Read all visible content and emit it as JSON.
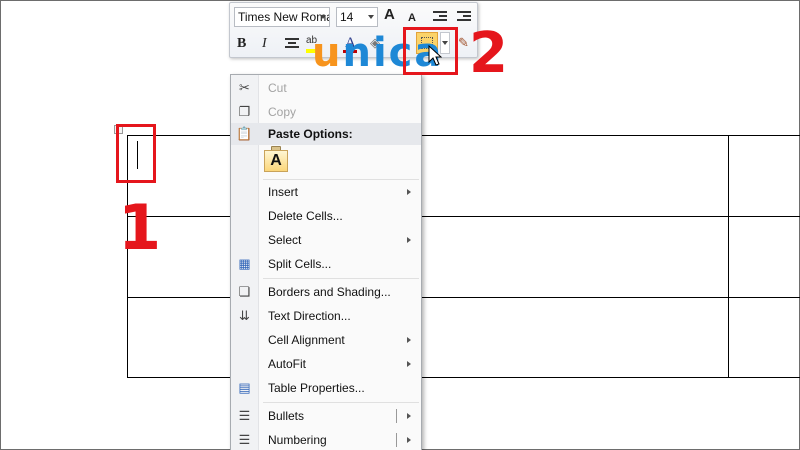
{
  "toolbar": {
    "font_name": "Times New Roman",
    "font_size": "14",
    "grow_font_glyph": "A",
    "shrink_font_glyph": "A",
    "bold_glyph": "B",
    "italic_glyph": "I",
    "highlight_glyph": "ab",
    "font_color_glyph": "A",
    "highlight_color": "#ffff00",
    "font_color": "#c00000"
  },
  "logo": {
    "first": "u",
    "rest": "nica"
  },
  "annotations": {
    "step1": "1",
    "step2": "2",
    "color": "#e5161c"
  },
  "context_menu": {
    "paste_option_glyph": "A",
    "items": [
      {
        "label": "Cut",
        "icon": "scissors-icon",
        "disabled": true
      },
      {
        "label": "Copy",
        "icon": "copy-icon",
        "disabled": true
      },
      {
        "label": "Paste Options:",
        "icon": "paste-icon",
        "header": true
      },
      {
        "label": "Insert",
        "submenu": true
      },
      {
        "label": "Delete Cells..."
      },
      {
        "label": "Select",
        "submenu": true
      },
      {
        "label": "Split Cells...",
        "icon": "split-cells-icon"
      },
      {
        "label": "Borders and Shading...",
        "icon": "borders-shading-icon"
      },
      {
        "label": "Text Direction...",
        "icon": "text-direction-icon"
      },
      {
        "label": "Cell Alignment",
        "submenu": true
      },
      {
        "label": "AutoFit",
        "submenu": true
      },
      {
        "label": "Table Properties...",
        "icon": "table-properties-icon"
      },
      {
        "label": "Bullets",
        "icon": "bullets-icon",
        "submenu": true
      },
      {
        "label": "Numbering",
        "icon": "numbering-icon",
        "submenu": true
      }
    ]
  }
}
